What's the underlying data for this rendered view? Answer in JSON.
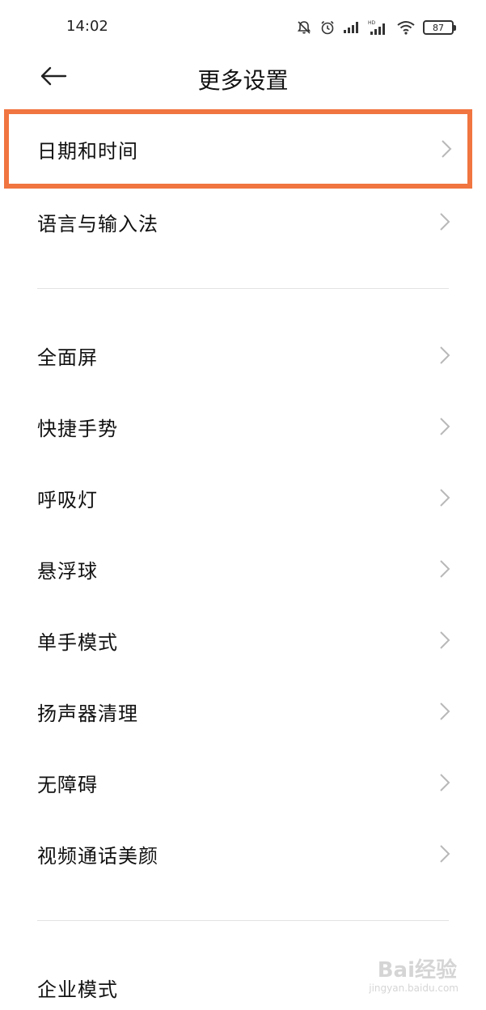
{
  "status_bar": {
    "time": "14:02",
    "battery": "87",
    "icons": [
      "mute-bell-icon",
      "alarm-icon",
      "signal-icon",
      "hd-signal-icon",
      "wifi-icon",
      "battery-icon"
    ]
  },
  "header": {
    "title": "更多设置",
    "back_icon": "back-arrow-icon"
  },
  "sections": [
    {
      "items": [
        {
          "label": "日期和时间",
          "highlighted": true
        },
        {
          "label": "语言与输入法"
        }
      ]
    },
    {
      "items": [
        {
          "label": "全面屏"
        },
        {
          "label": "快捷手势"
        },
        {
          "label": "呼吸灯"
        },
        {
          "label": "悬浮球"
        },
        {
          "label": "单手模式"
        },
        {
          "label": "扬声器清理"
        },
        {
          "label": "无障碍"
        },
        {
          "label": "视频通话美颜"
        }
      ]
    },
    {
      "items": [
        {
          "label": "企业模式"
        }
      ]
    }
  ],
  "highlight_color": "#f07540",
  "watermark": {
    "brand": "Bai经验",
    "sub": "jingyan.baidu.com"
  }
}
